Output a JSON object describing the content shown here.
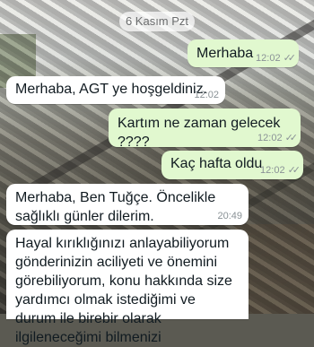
{
  "chat": {
    "date_chip": "6 Kasım Pzt",
    "messages": [
      {
        "direction": "outgoing",
        "text": "Merhaba",
        "time": "12:02",
        "status": "read"
      },
      {
        "direction": "incoming",
        "text": "Merhaba, AGT ye hoşgeldiniz.",
        "time": "12:02"
      },
      {
        "direction": "outgoing",
        "text": "Kartım ne zaman gelecek ????",
        "time": "12:02",
        "status": "read"
      },
      {
        "direction": "outgoing",
        "text": "Kaç hafta oldu",
        "time": "12:02",
        "status": "read"
      },
      {
        "direction": "incoming",
        "text": "Merhaba, Ben Tuğçe. Öncelikle sağlıklı günler dilerim.",
        "time": "20:49"
      },
      {
        "direction": "incoming",
        "text": "Hayal kırıklığınızı anlayabiliyorum gönderinizin aciliyeti ve önemini görebiliyorum, konu hakkında size yardımcı olmak istediğimi ve durum ile birebir olarak ilgileneceğimi bilmenizi"
      }
    ]
  },
  "colors": {
    "outgoing_bubble": "#e1f8cf",
    "incoming_bubble": "#ffffff",
    "meta_text": "#8a9296"
  },
  "icons": {
    "read_receipt": "double-check-icon"
  }
}
